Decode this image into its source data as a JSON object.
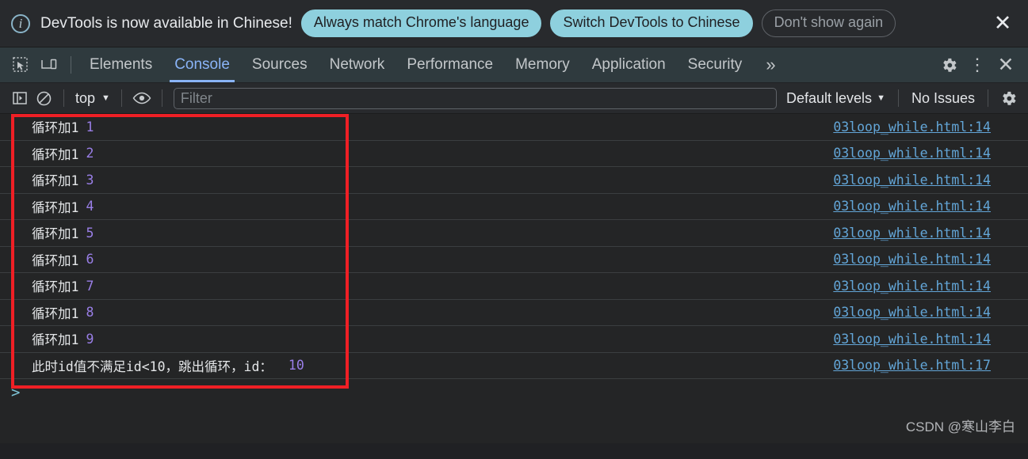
{
  "notification": {
    "icon": "info-circle-icon",
    "message": "DevTools is now available in Chinese!",
    "primary_button": "Always match Chrome's language",
    "secondary_button": "Switch DevTools to Chinese",
    "dismiss_button": "Don't show again",
    "close_icon": "close-icon",
    "accent_color": "#8ed0de"
  },
  "tabbar": {
    "inspect_icon": "inspect-element-icon",
    "device_icon": "device-toolbar-icon",
    "tabs": [
      {
        "label": "Elements",
        "active": false
      },
      {
        "label": "Console",
        "active": true
      },
      {
        "label": "Sources",
        "active": false
      },
      {
        "label": "Network",
        "active": false
      },
      {
        "label": "Performance",
        "active": false
      },
      {
        "label": "Memory",
        "active": false
      },
      {
        "label": "Application",
        "active": false
      },
      {
        "label": "Security",
        "active": false
      }
    ],
    "more_tabs": "»",
    "settings_icon": "gear-icon",
    "menu_icon": "kebab-menu-icon",
    "close_icon": "close-icon",
    "active_color": "#8ab4f8"
  },
  "console_toolbar": {
    "sidebar_icon": "console-sidebar-icon",
    "clear_icon": "clear-console-icon",
    "context": "top",
    "context_caret": "▼",
    "eye_icon": "live-expression-eye-icon",
    "filter_placeholder": "Filter",
    "filter_value": "",
    "levels_label": "Default levels",
    "levels_caret": "▼",
    "issues_label": "No Issues",
    "settings_icon": "gear-icon"
  },
  "console": {
    "prompt": ">",
    "messages": [
      {
        "text": "循环加1",
        "value": "1",
        "source": "03loop_while.html:14"
      },
      {
        "text": "循环加1",
        "value": "2",
        "source": "03loop_while.html:14"
      },
      {
        "text": "循环加1",
        "value": "3",
        "source": "03loop_while.html:14"
      },
      {
        "text": "循环加1",
        "value": "4",
        "source": "03loop_while.html:14"
      },
      {
        "text": "循环加1",
        "value": "5",
        "source": "03loop_while.html:14"
      },
      {
        "text": "循环加1",
        "value": "6",
        "source": "03loop_while.html:14"
      },
      {
        "text": "循环加1",
        "value": "7",
        "source": "03loop_while.html:14"
      },
      {
        "text": "循环加1",
        "value": "8",
        "source": "03loop_while.html:14"
      },
      {
        "text": "循环加1",
        "value": "9",
        "source": "03loop_while.html:14"
      },
      {
        "text": "此时id值不满足id<10，跳出循环，id：",
        "value": "10",
        "source": "03loop_while.html:17"
      }
    ],
    "highlight_color": "#ef1f25",
    "number_color": "#9a7fe8",
    "link_color": "#63a6d8"
  },
  "watermark": "CSDN @寒山李白"
}
